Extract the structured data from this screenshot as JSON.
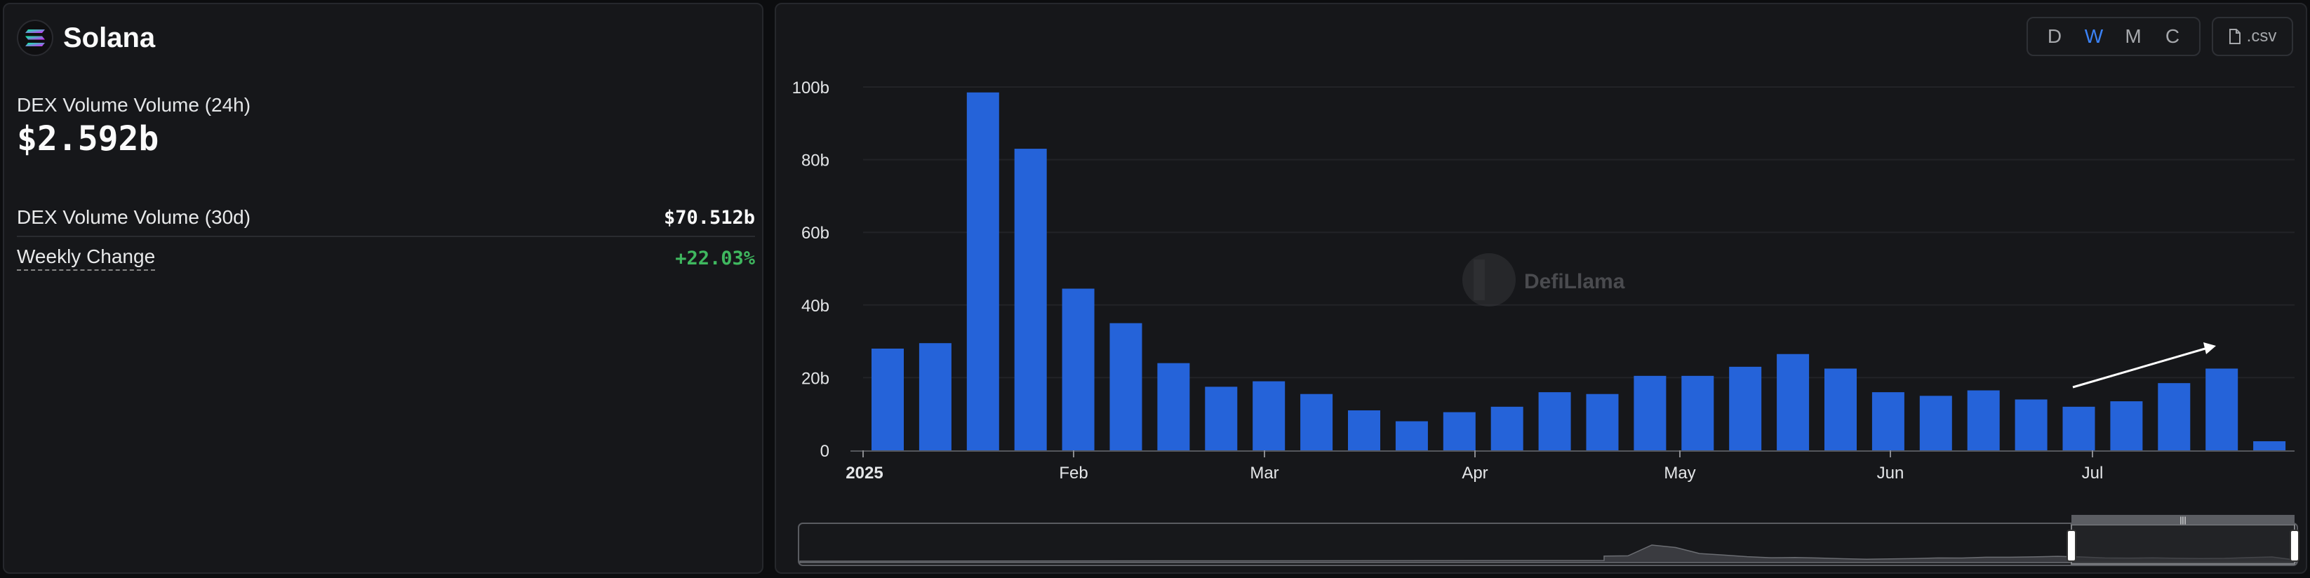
{
  "summary": {
    "chain_name": "Solana",
    "stat_24h_label": "DEX Volume Volume (24h)",
    "stat_24h_value": "$2.592b",
    "stat_30d_label": "DEX Volume Volume (30d)",
    "stat_30d_value": "$70.512b",
    "weekly_change_label": "Weekly Change",
    "weekly_change_value": "+22.03%"
  },
  "controls": {
    "granularity": [
      "D",
      "W",
      "M",
      "C"
    ],
    "active_granularity": "W",
    "csv_label": ".csv"
  },
  "watermark": "DefiLlama",
  "colors": {
    "bar": "#2563d9",
    "accent": "#3b82f6",
    "positive": "#3fb85f"
  },
  "chart_data": {
    "type": "bar",
    "x_tick_labels": [
      "2025",
      "Feb",
      "Mar",
      "Apr",
      "May",
      "Jun",
      "Jul"
    ],
    "y_tick_labels": [
      "0",
      "20b",
      "40b",
      "60b",
      "80b",
      "100b"
    ],
    "ylim": [
      0,
      100
    ],
    "ylabel_unit": "b",
    "grid": true,
    "series": [
      {
        "values": [
          28,
          29.5,
          98.5,
          83,
          44.5,
          35,
          24,
          17.5,
          19,
          15.5,
          11,
          8,
          10.5,
          12,
          16,
          15.5,
          20.5,
          20.5,
          23,
          26.5,
          22.5,
          16,
          15,
          16.5,
          14,
          12,
          13.5,
          18.5,
          22.5,
          2.5
        ]
      }
    ]
  }
}
